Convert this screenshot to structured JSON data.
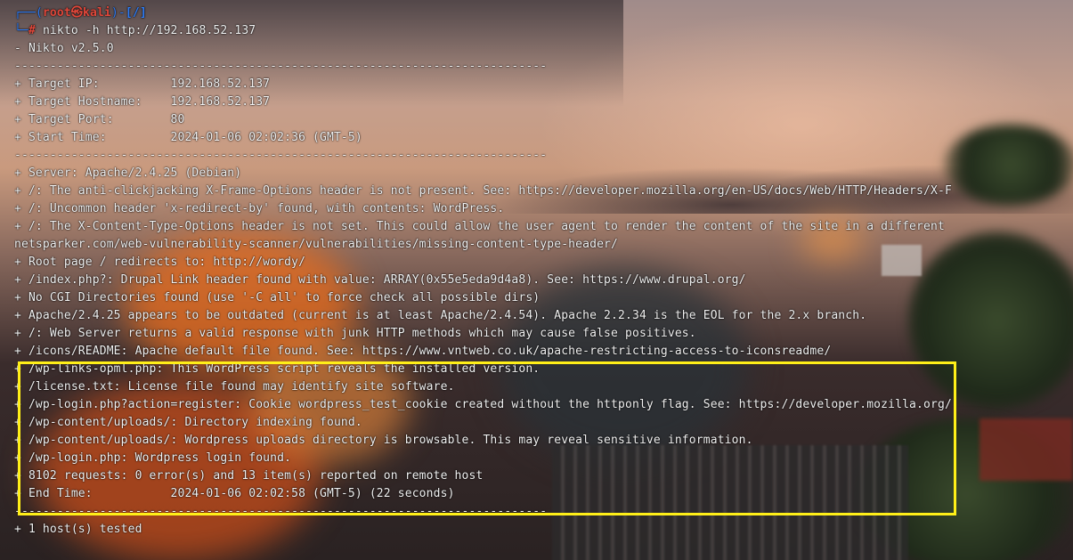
{
  "prompt": {
    "corner_top": "┌──",
    "open": "(",
    "user": "root",
    "glyph": "㉿",
    "host": "kali",
    "close": ")",
    "dash": "-",
    "dir": "[/]",
    "corner_bottom": "└─",
    "symbol": "#",
    "command": "nikto",
    "option": "-h",
    "argument": "http://192.168.52.137"
  },
  "output": {
    "banner": "- Nikto v2.5.0",
    "separator": "---------------------------------------------------------------------------",
    "target_lines": [
      "+ Target IP:          192.168.52.137",
      "+ Target Hostname:    192.168.52.137",
      "+ Target Port:        80",
      "+ Start Time:         2024-01-06 02:02:36 (GMT-5)"
    ],
    "separator2": "---------------------------------------------------------------------------",
    "findings": [
      "+ Server: Apache/2.4.25 (Debian)",
      "+ /: The anti-clickjacking X-Frame-Options header is not present. See: https://developer.mozilla.org/en-US/docs/Web/HTTP/Headers/X-F",
      "+ /: Uncommon header 'x-redirect-by' found, with contents: WordPress.",
      "+ /: The X-Content-Type-Options header is not set. This could allow the user agent to render the content of the site in a different",
      "netsparker.com/web-vulnerability-scanner/vulnerabilities/missing-content-type-header/",
      "+ Root page / redirects to: http://wordy/",
      "+ /index.php?: Drupal Link header found with value: ARRAY(0x55e5eda9d4a8). See: https://www.drupal.org/",
      "+ No CGI Directories found (use '-C all' to force check all possible dirs)",
      "+ Apache/2.4.25 appears to be outdated (current is at least Apache/2.4.54). Apache 2.2.34 is the EOL for the 2.x branch.",
      "+ /: Web Server returns a valid response with junk HTTP methods which may cause false positives.",
      "+ /icons/README: Apache default file found. See: https://www.vntweb.co.uk/apache-restricting-access-to-iconsreadme/"
    ],
    "highlighted": [
      "+ /wp-links-opml.php: This WordPress script reveals the installed version.",
      "+ /license.txt: License file found may identify site software.",
      "+ /wp-login.php?action=register: Cookie wordpress_test_cookie created without the httponly flag. See: https://developer.mozilla.org/",
      "+ /wp-content/uploads/: Directory indexing found.",
      "+ /wp-content/uploads/: Wordpress uploads directory is browsable. This may reveal sensitive information.",
      "+ /wp-login.php: Wordpress login found.",
      "+ 8102 requests: 0 error(s) and 13 item(s) reported on remote host",
      "+ End Time:           2024-01-06 02:02:58 (GMT-5) (22 seconds)"
    ],
    "separator3": "---------------------------------------------------------------------------",
    "summary": "+ 1 host(s) tested"
  },
  "colors": {
    "prompt_frame": "#2e7cf6",
    "prompt_user": "#e0473a",
    "text": "#f2f2f2",
    "highlight_border": "#ffef18"
  }
}
